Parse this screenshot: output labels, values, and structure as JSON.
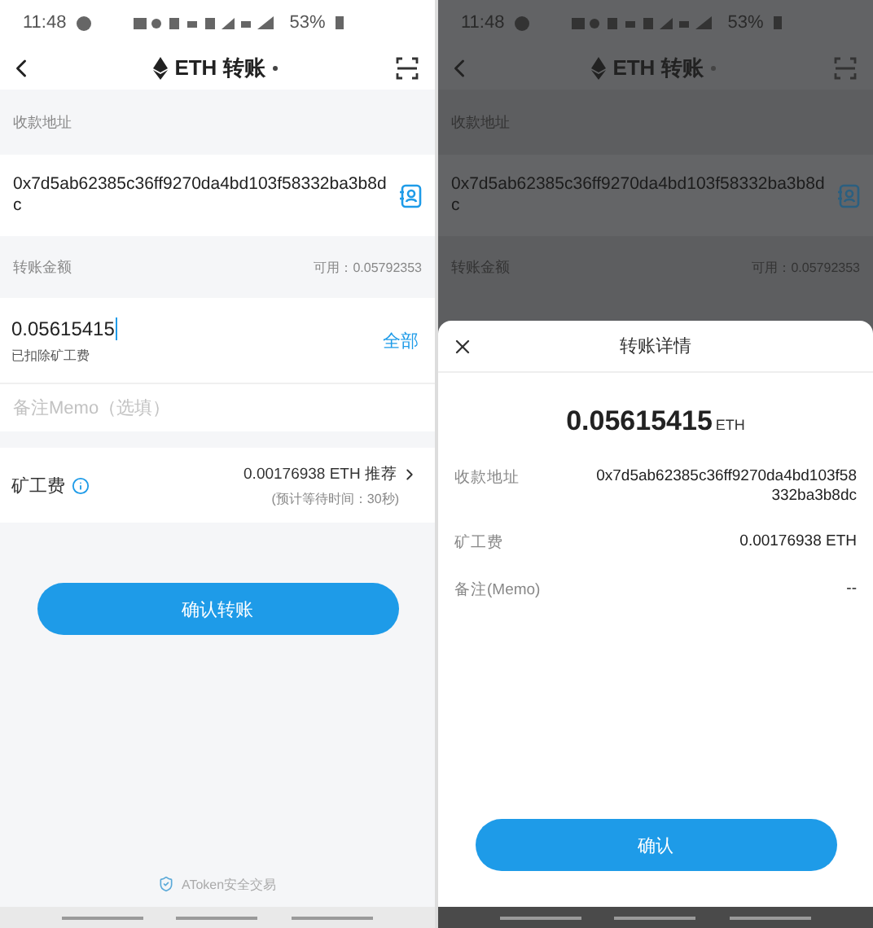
{
  "screens": [
    {
      "status_bar": {
        "time": "11:48",
        "battery": "53%"
      },
      "header": {
        "title": "ETH 转账"
      },
      "address": {
        "label": "收款地址",
        "value": "0x7d5ab62385c36ff9270da4bd103f58332ba3b8dc"
      },
      "amount": {
        "label": "转账金额",
        "available": "可用：0.05792353",
        "value": "0.05615415",
        "note": "已扣除矿工费",
        "all_button": "全部"
      },
      "memo": {
        "placeholder": "备注Memo（选填）"
      },
      "fee": {
        "label": "矿工费",
        "value": "0.00176938 ETH 推荐",
        "wait": "(预计等待时间：30秒)"
      },
      "confirm_button": "确认转账",
      "footer": "AToken安全交易"
    },
    {
      "status_bar": {
        "time": "11:48",
        "battery": "53%"
      },
      "header": {
        "title": "ETH 转账"
      },
      "address": {
        "label": "收款地址",
        "value": "0x7d5ab62385c36ff9270da4bd103f58332ba3b8dc"
      },
      "amount": {
        "label": "转账金额",
        "available": "可用：0.05792353"
      },
      "sheet": {
        "title": "转账详情",
        "amount": "0.05615415",
        "unit": "ETH",
        "rows": [
          {
            "label": "收款地址",
            "value": "0x7d5ab62385c36ff9270da4bd103f58332ba3b8dc"
          },
          {
            "label": "矿工费",
            "value": "0.00176938 ETH"
          },
          {
            "label": "备注(Memo)",
            "value": "--"
          }
        ],
        "button": "确认"
      }
    }
  ]
}
